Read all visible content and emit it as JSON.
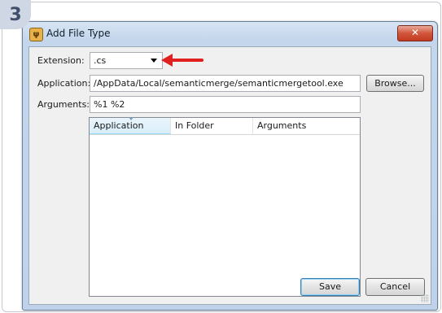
{
  "step_badge": "3",
  "window": {
    "title": "Add File Type",
    "close_glyph": "✕"
  },
  "form": {
    "extension_label": "Extension:",
    "extension_value": ".cs",
    "application_label": "Application:",
    "application_value": "/AppData/Local/semanticmerge/semanticmergetool.exe",
    "arguments_label": "Arguments:",
    "arguments_value": "%1 %2"
  },
  "buttons": {
    "browse": "Browse...",
    "save": "Save",
    "cancel": "Cancel"
  },
  "table": {
    "columns": [
      "Application",
      "In Folder",
      "Arguments"
    ],
    "rows": []
  },
  "annotation": {
    "arrow_color": "#e0201e"
  }
}
